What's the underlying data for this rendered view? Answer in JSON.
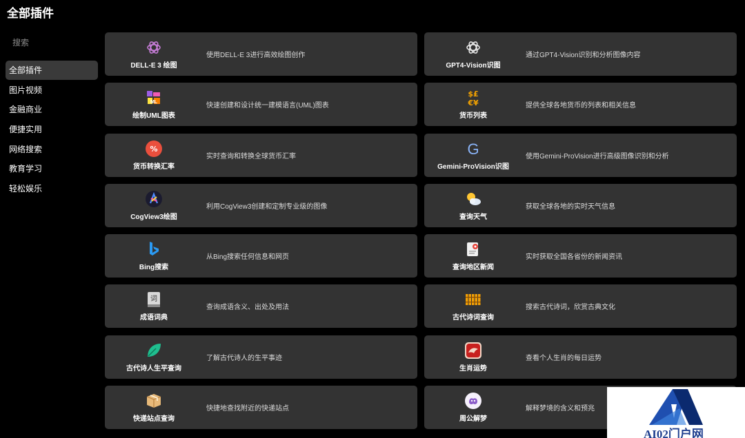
{
  "page": {
    "title": "全部插件"
  },
  "sidebar": {
    "search_placeholder": "搜索",
    "items": [
      {
        "label": "全部插件",
        "active": true
      },
      {
        "label": "图片视频"
      },
      {
        "label": "金融商业"
      },
      {
        "label": "便捷实用"
      },
      {
        "label": "网络搜索"
      },
      {
        "label": "教育学习"
      },
      {
        "label": "轻松娱乐"
      }
    ]
  },
  "plugins": [
    {
      "name": "DELL-E 3 绘图",
      "desc": "使用DELL-E 3进行高效绘图创作",
      "icon": "openai-icon"
    },
    {
      "name": "GPT4-Vision识图",
      "desc": "通过GPT4-Vision识别和分析图像内容",
      "icon": "openai-icon"
    },
    {
      "name": "绘制UML图表",
      "desc": "快速创建和设计统一建模语言(UML)图表",
      "icon": "uml-icon"
    },
    {
      "name": "货币列表",
      "desc": "提供全球各地货币的列表和相关信息",
      "icon": "currency-symbols-icon",
      "icon_text": "$£\n€¥"
    },
    {
      "name": "货币转换汇率",
      "desc": "实时查询和转换全球货币汇率",
      "icon": "exchange-rate-icon",
      "icon_text": "%"
    },
    {
      "name": "Gemini-ProVision识图",
      "desc": "使用Gemini-ProVision进行高级图像识别和分析",
      "icon": "google-g-icon",
      "icon_text": "G"
    },
    {
      "name": "CogView3绘图",
      "desc": "利用CogView3创建和定制专业级的图像",
      "icon": "cogview-icon"
    },
    {
      "name": "查询天气",
      "desc": "获取全球各地的实时天气信息",
      "icon": "weather-icon"
    },
    {
      "name": "Bing搜索",
      "desc": "从Bing搜索任何信息和网页",
      "icon": "bing-icon"
    },
    {
      "name": "查询地区新闻",
      "desc": "实时获取全国各省份的新闻资讯",
      "icon": "news-location-icon"
    },
    {
      "name": "成语词典",
      "desc": "查询成语含义、出处及用法",
      "icon": "dictionary-icon",
      "icon_text": "词"
    },
    {
      "name": "古代诗词查询",
      "desc": "搜索古代诗词，欣赏古典文化",
      "icon": "bamboo-scroll-icon"
    },
    {
      "name": "古代诗人生平查询",
      "desc": "了解古代诗人的生平事迹",
      "icon": "leaf-icon"
    },
    {
      "name": "生肖运势",
      "desc": "查看个人生肖的每日运势",
      "icon": "zodiac-icon"
    },
    {
      "name": "快递站点查询",
      "desc": "快捷地查找附近的快递站点",
      "icon": "package-icon"
    },
    {
      "name": "周公解梦",
      "desc": "解释梦境的含义和预兆",
      "icon": "dream-icon"
    }
  ],
  "watermark": {
    "text": "AI02门户网",
    "color": "#1f3f8f"
  }
}
